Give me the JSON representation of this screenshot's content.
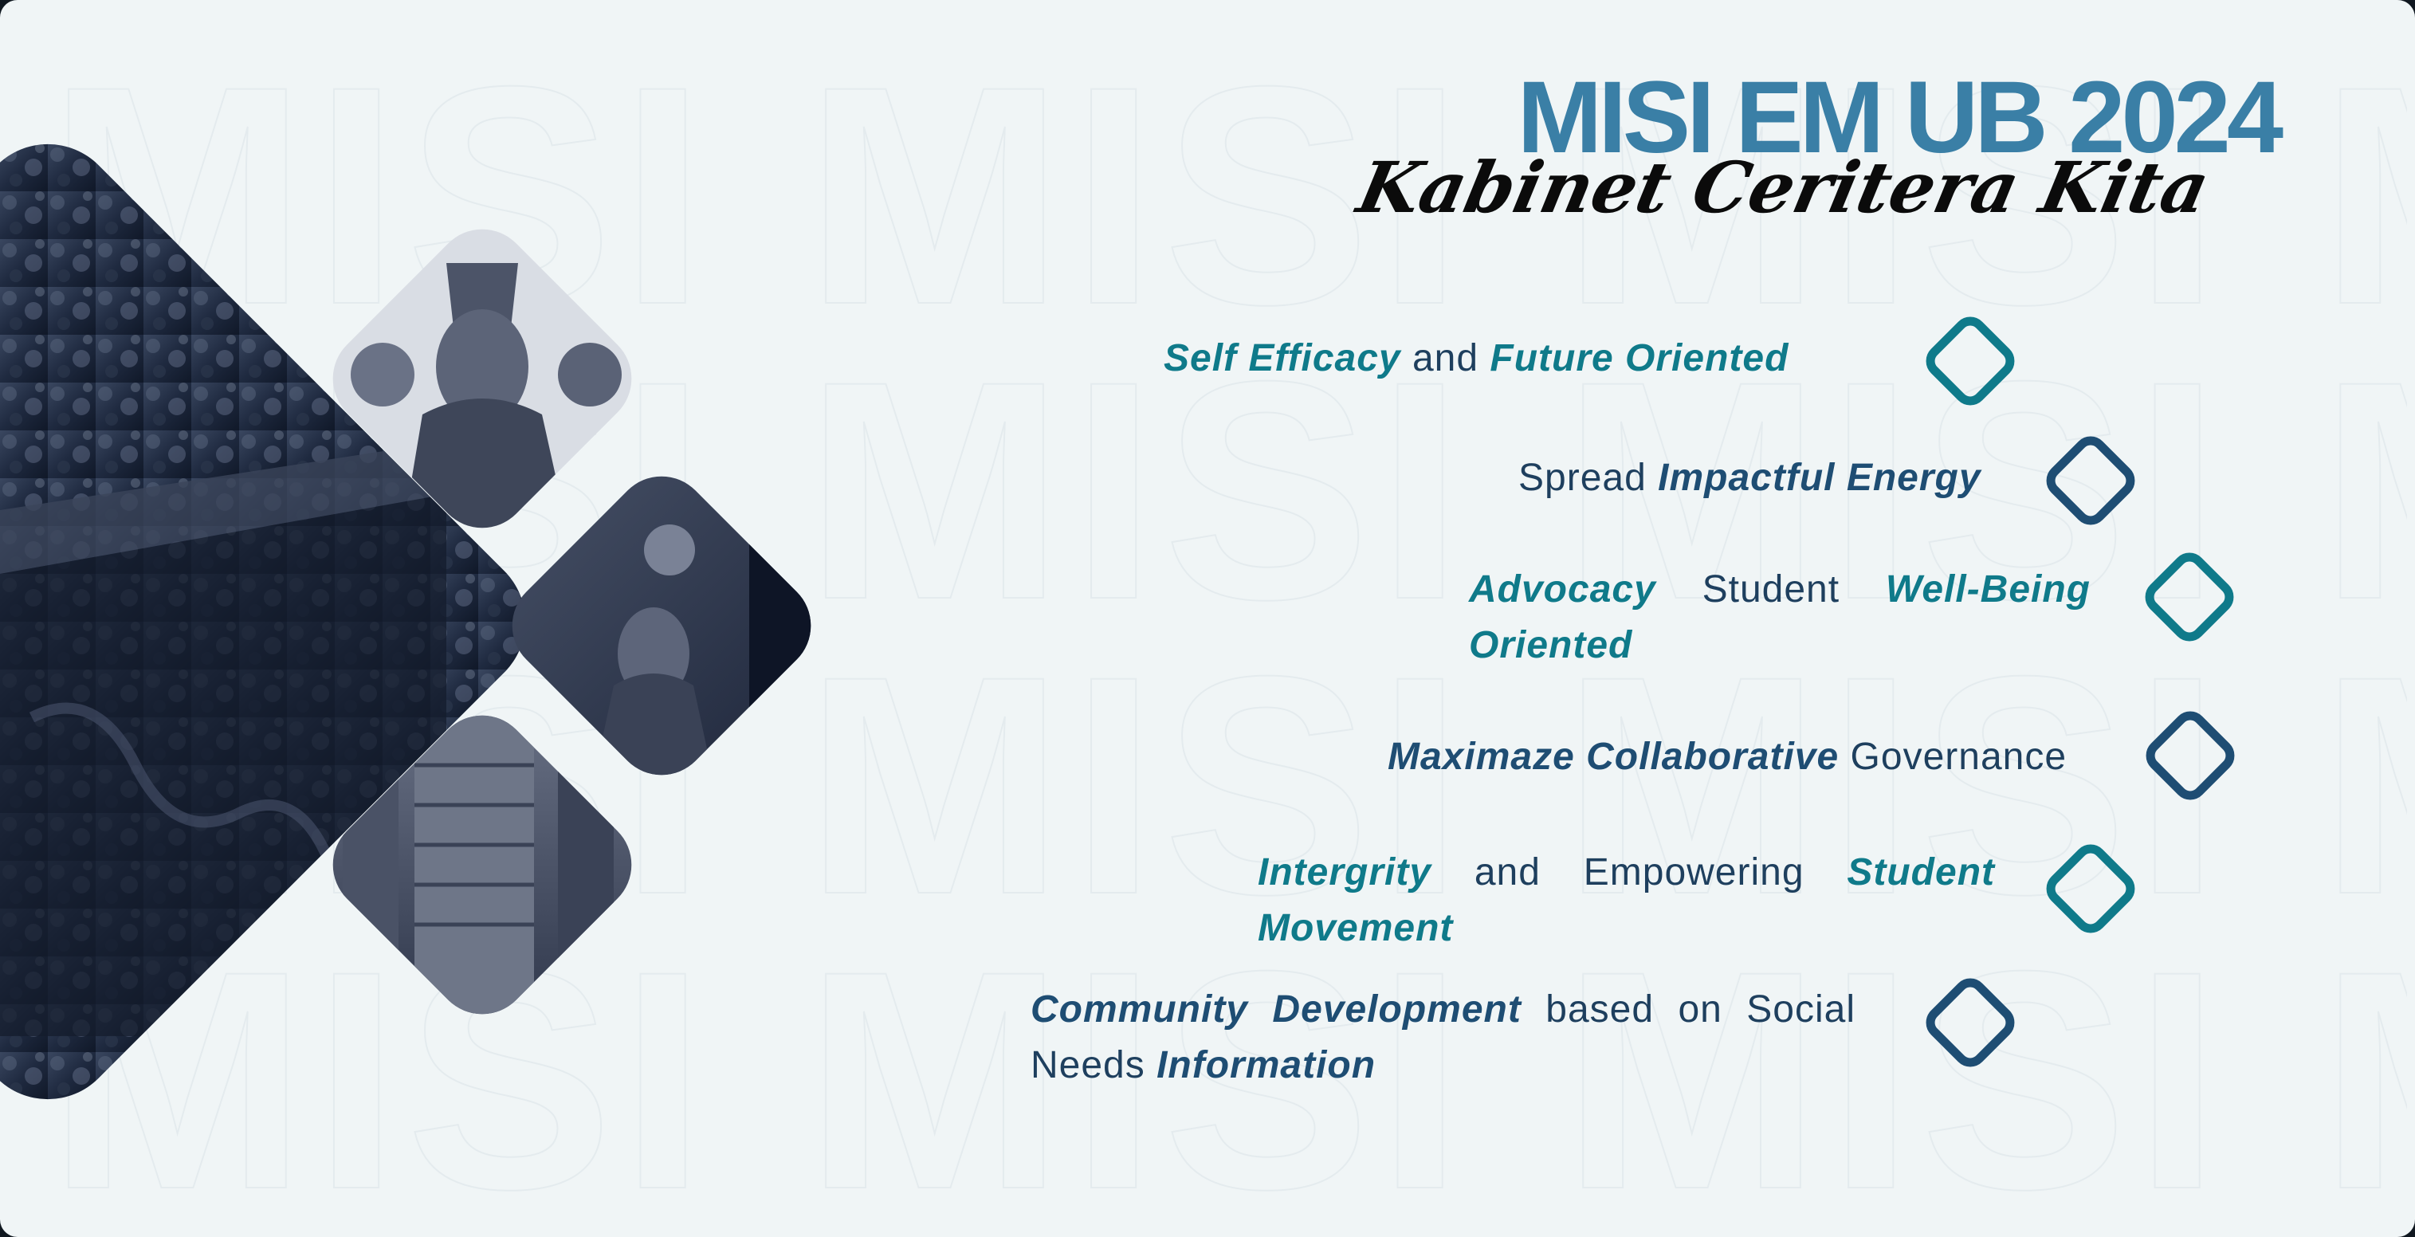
{
  "title": "MISI EM UB 2024",
  "subtitle": "Kabinet Ceritera Kita",
  "watermark_word": "MISI",
  "colors": {
    "teal": "#0f7a8a",
    "navy": "#1e4d73",
    "title": "#3a7fa6",
    "background": "#f0f5f6"
  },
  "missions": [
    {
      "parts": [
        "Self Efficacy",
        " and ",
        "Future Oriented",
        ""
      ]
    },
    {
      "parts": [
        "Spread ",
        "Impactful Energy"
      ]
    },
    {
      "parts": [
        "Advocacy",
        " Student ",
        "Well-Being Oriented",
        ""
      ]
    },
    {
      "parts": [
        "Maximaze Collaborative",
        " Governance"
      ]
    },
    {
      "parts": [
        "Intergrity",
        " and Empowering ",
        "Student Movement",
        ""
      ]
    },
    {
      "parts": [
        "Community Development",
        " based on Social Needs ",
        "Information",
        ""
      ]
    }
  ],
  "icons": {
    "diamond": "rounded-diamond-outline-icon",
    "photo": "temple-statue-photo"
  }
}
